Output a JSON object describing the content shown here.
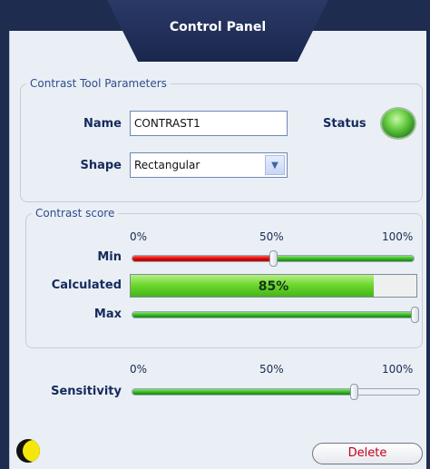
{
  "header": {
    "title": "Control Panel"
  },
  "parameters": {
    "legend": "Contrast Tool Parameters",
    "name_label": "Name",
    "name_value": "CONTRAST1",
    "shape_label": "Shape",
    "shape_value": "Rectangular",
    "status_label": "Status",
    "status_color": "#4fc232"
  },
  "contrast_score": {
    "legend": "Contrast score",
    "scale_labels": [
      "0%",
      "50%",
      "100%"
    ],
    "min_label": "Min",
    "min_value_percent": 50,
    "calculated_label": "Calculated",
    "calculated_value_percent": 85,
    "calculated_text": "85%",
    "max_label": "Max",
    "max_value_percent": 100
  },
  "sensitivity": {
    "scale_labels": [
      "0%",
      "50%",
      "100%"
    ],
    "label": "Sensitivity",
    "value_percent": 77
  },
  "footer": {
    "mode_icon": "moon-icon",
    "delete_label": "Delete"
  },
  "colors": {
    "background": "#1e2c50",
    "panel": "#e9eff5",
    "red_bar": "#d90000",
    "green_bar": "#2fb11e",
    "delete_text": "#c0001a"
  }
}
